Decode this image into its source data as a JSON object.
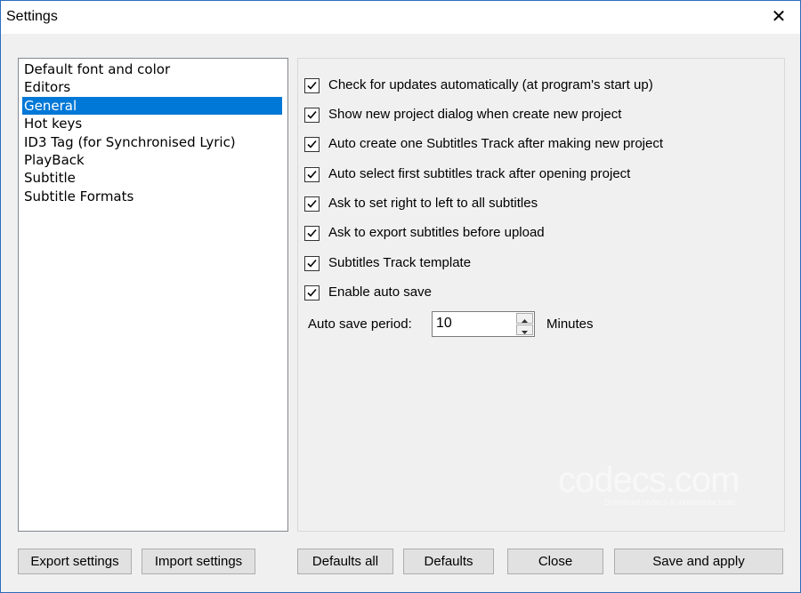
{
  "window": {
    "title": "Settings"
  },
  "categories": [
    "Default font and color",
    "Editors",
    "General",
    "Hot keys",
    "ID3 Tag (for Synchronised Lyric)",
    "PlayBack",
    "Subtitle",
    "Subtitle Formats"
  ],
  "selected_category": "General",
  "options": [
    {
      "label": "Check for updates automatically (at program's start up)",
      "checked": true
    },
    {
      "label": "Show new project dialog when create new project",
      "checked": true
    },
    {
      "label": "Auto create one Subtitles Track after making new project",
      "checked": true
    },
    {
      "label": "Auto select first subtitles track after opening project",
      "checked": true
    },
    {
      "label": "Ask to set right to left to all subtitles",
      "checked": true
    },
    {
      "label": "Ask to export subtitles before upload",
      "checked": true
    },
    {
      "label": "Subtitles Track template",
      "checked": true
    },
    {
      "label": "Enable auto save",
      "checked": true
    }
  ],
  "auto_save": {
    "label": "Auto save period:",
    "value": "10",
    "unit": "Minutes"
  },
  "watermark": {
    "text": "codecs.com",
    "sub": "Download codecs & multimedia tools"
  },
  "buttons": {
    "export": "Export settings",
    "import": "Import settings",
    "defaults_all": "Defaults all",
    "defaults": "Defaults",
    "close": "Close",
    "save_apply": "Save and apply"
  }
}
